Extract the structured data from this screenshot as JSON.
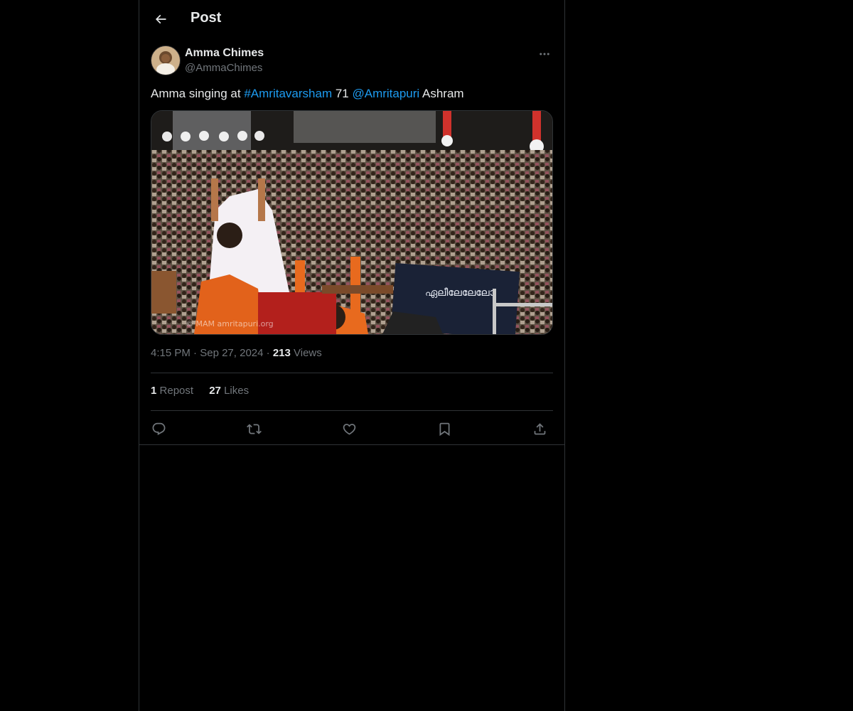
{
  "header": {
    "title": "Post",
    "back_icon": "arrow-left-icon"
  },
  "post": {
    "author_name": "Amma Chimes",
    "author_handle": "@AmmaChimes",
    "text_prefix": "Amma singing at ",
    "hashtag": "#Amritavarsham",
    "text_mid": " 71 ",
    "mention": "@Amritapuri",
    "text_suffix": " Ashram",
    "image_watermark": "© MAM amritapuri.org",
    "banner_text": "ഏലീലേലേലോ",
    "time": "4:15 PM",
    "separator": "·",
    "date": "Sep 27, 2024",
    "views_count": "213",
    "views_label": "Views",
    "reposts_count": "1",
    "reposts_label": "Repost",
    "likes_count": "27",
    "likes_label": "Likes"
  },
  "actions": [
    {
      "name": "reply-icon"
    },
    {
      "name": "repost-icon"
    },
    {
      "name": "like-icon"
    },
    {
      "name": "bookmark-icon"
    },
    {
      "name": "share-icon"
    }
  ],
  "colors": {
    "background": "#000000",
    "text": "#e7e9ea",
    "muted": "#71767b",
    "link": "#1d9bf0",
    "border": "#2f3336"
  }
}
